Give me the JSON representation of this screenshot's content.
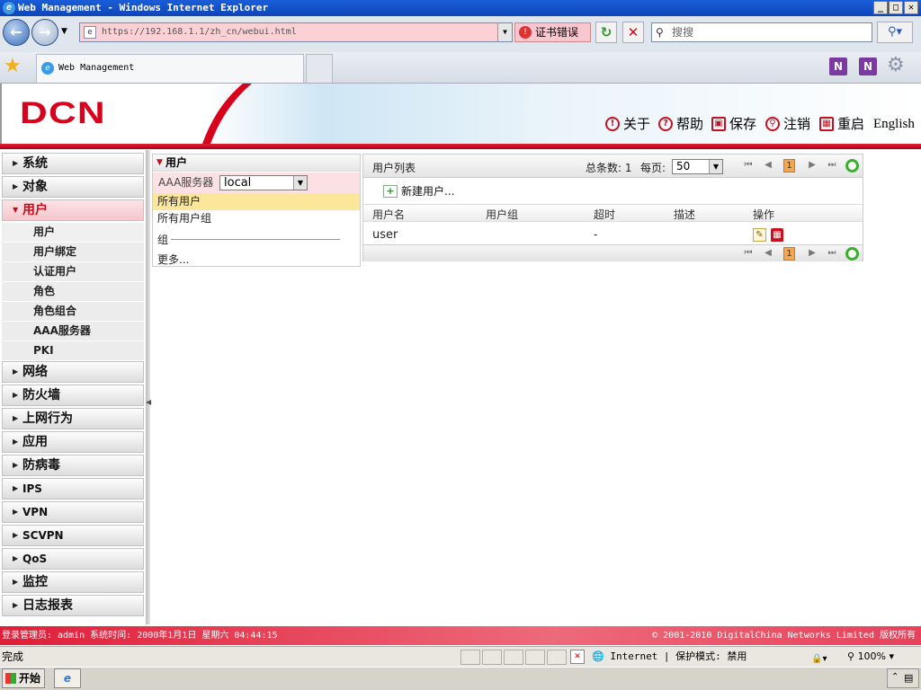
{
  "window": {
    "title": "Web Management - Windows Internet Explorer",
    "minimize": "_",
    "maximize": "□",
    "close": "✕"
  },
  "browser": {
    "url": "https://192.168.1.1/zh_cn/webui.html",
    "cert_error": "证书错误",
    "search_placeholder": "搜搜",
    "tab_title": "Web Management",
    "zoom": "100%",
    "zone": "Internet | 保护模式: 禁用",
    "status_text": "完成"
  },
  "header": {
    "logo": "DCN",
    "links": [
      {
        "label": "关于",
        "icon": "info-icon"
      },
      {
        "label": "帮助",
        "icon": "help-icon"
      },
      {
        "label": "保存",
        "icon": "save-icon"
      },
      {
        "label": "注销",
        "icon": "logout-icon"
      },
      {
        "label": "重启",
        "icon": "reboot-icon"
      }
    ],
    "language": "English"
  },
  "sidebar": {
    "items_before": [
      "系统",
      "对象"
    ],
    "active": "用户",
    "subitems": [
      "用户",
      "用户绑定",
      "认证用户",
      "角色",
      "角色组合",
      "AAA服务器",
      "PKI"
    ],
    "items_after": [
      "网络",
      "防火墙",
      "上网行为",
      "应用",
      "防病毒",
      "IPS",
      "VPN",
      "SCVPN",
      "QoS",
      "监控",
      "日志报表"
    ]
  },
  "user_panel": {
    "title": "用户",
    "aaa_label": "AAA服务器",
    "aaa_value": "local",
    "all_users": "所有用户",
    "all_groups": "所有用户组",
    "group": "组",
    "more": "更多..."
  },
  "user_list": {
    "title": "用户列表",
    "total_label": "总条数: 1",
    "per_page_label": "每页:",
    "per_page_value": "50",
    "current_page": "1",
    "new_user": "新建用户...",
    "columns": [
      "用户名",
      "用户组",
      "超时",
      "描述",
      "操作"
    ],
    "rows": [
      {
        "username": "user",
        "group": "",
        "timeout": "-",
        "description": ""
      }
    ]
  },
  "footer": {
    "login_info": "登录管理员: admin 系统时间: 2000年1月1日 星期六 04:44:15",
    "copyright": "© 2001-2010 DigitalChina Networks Limited 版权所有"
  },
  "taskbar": {
    "start": "开始"
  }
}
